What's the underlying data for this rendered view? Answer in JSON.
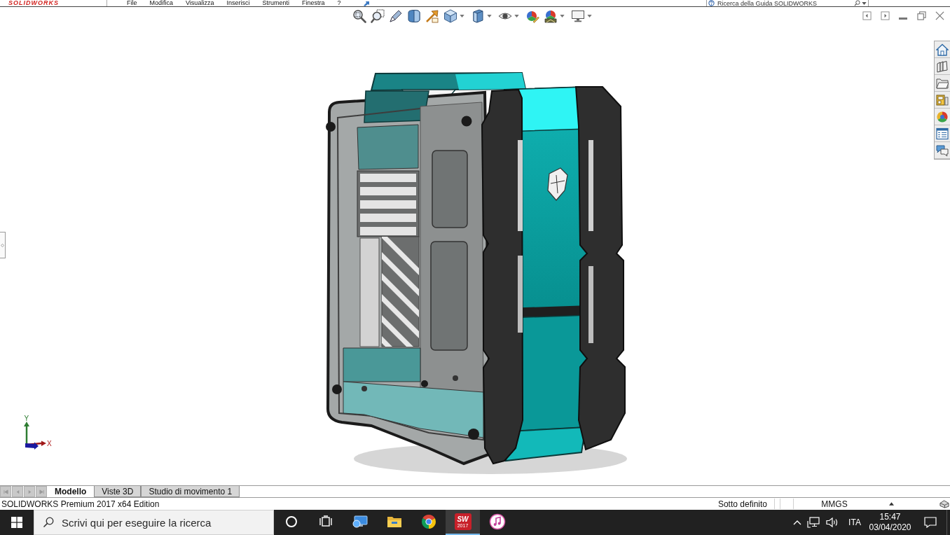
{
  "menu_bar": {
    "logo": "SOLIDWORKS",
    "items": [
      "File",
      "Modifica",
      "Visualizza",
      "Inserisci",
      "Strumenti",
      "Finestra",
      "?"
    ],
    "help_search": {
      "placeholder": "Ricerca della Guida SOLIDWORKS"
    }
  },
  "triad": {
    "y_label": "Y",
    "x_label": "X"
  },
  "document_tabs": [
    {
      "label": "Modello",
      "selected": true
    },
    {
      "label": "Viste 3D",
      "selected": false
    },
    {
      "label": "Studio di movimento 1",
      "selected": false
    }
  ],
  "status_bar": {
    "product": "SOLIDWORKS Premium 2017 x64 Edition",
    "definition": "Sotto definito",
    "units": "MMGS"
  },
  "taskbar": {
    "search": {
      "placeholder": "Scrivi qui per eseguire la ricerca"
    },
    "apps": [
      {
        "kind": "circle",
        "selected": false
      },
      {
        "kind": "task-view",
        "selected": false
      },
      {
        "kind": "monitor",
        "selected": false
      },
      {
        "kind": "folder",
        "selected": false
      },
      {
        "kind": "ball",
        "selected": false
      },
      {
        "kind": "cad",
        "selected": true,
        "logo_lines": [
          "SW",
          "2017"
        ]
      },
      {
        "kind": "music",
        "selected": false
      }
    ],
    "language": "ITA",
    "time": "15:47",
    "date": "03/04/2020"
  }
}
